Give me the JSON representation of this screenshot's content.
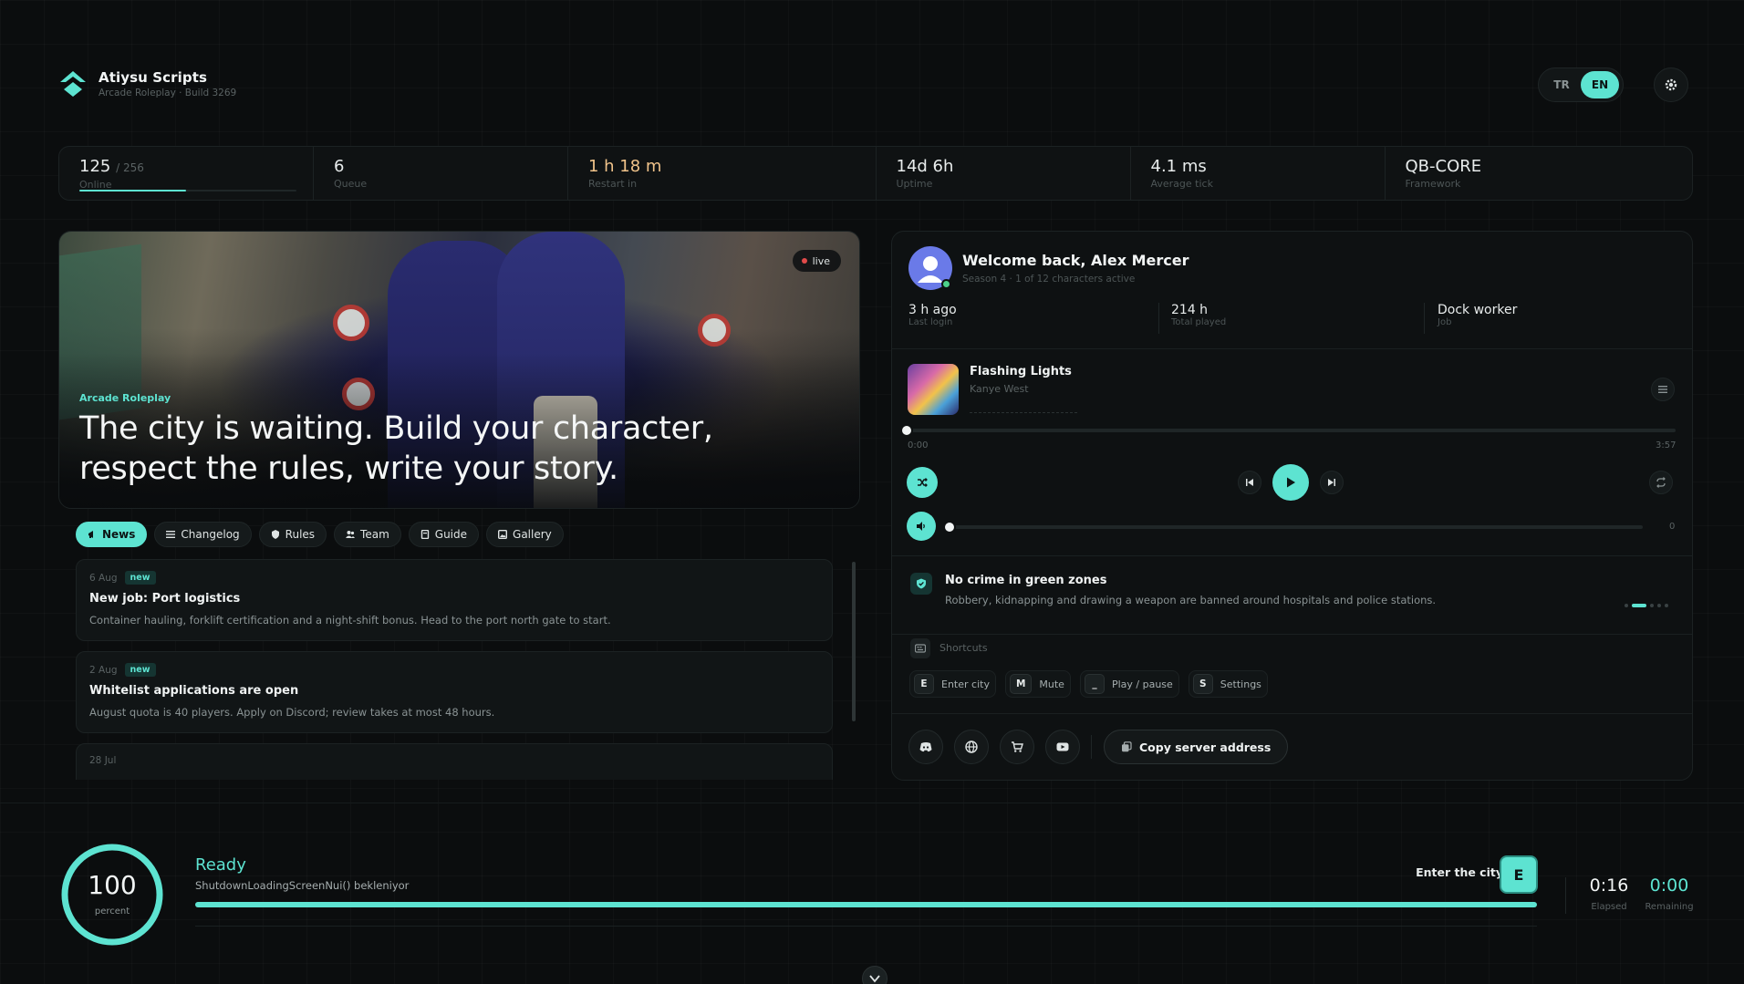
{
  "brand": {
    "title": "Atiysu Scripts",
    "subtitle": "Arcade Roleplay · Build 3269"
  },
  "lang": {
    "tr": "TR",
    "en": "EN",
    "active": "EN"
  },
  "stats": [
    {
      "value": "125",
      "max": "/ 256",
      "label": "Online",
      "progress": 0.49
    },
    {
      "value": "6",
      "label": "Queue"
    },
    {
      "value": "1 h 18 m",
      "label": "Restart in"
    },
    {
      "value": "14d 6h",
      "label": "Uptime"
    },
    {
      "value": "4.1 ms",
      "label": "Average tick"
    },
    {
      "value": "QB-CORE",
      "label": "Framework"
    }
  ],
  "hero": {
    "live": "live",
    "tag": "Arcade Roleplay",
    "title": "The city is waiting. Build your character, respect the rules, write your story."
  },
  "tabs": [
    {
      "label": "News",
      "icon": "megaphone-icon"
    },
    {
      "label": "Changelog",
      "icon": "list-icon"
    },
    {
      "label": "Rules",
      "icon": "shield-icon"
    },
    {
      "label": "Team",
      "icon": "users-icon"
    },
    {
      "label": "Guide",
      "icon": "book-icon"
    },
    {
      "label": "Gallery",
      "icon": "image-icon"
    }
  ],
  "news": [
    {
      "date": "6 Aug",
      "badge": "new",
      "title": "New job: Port logistics",
      "desc": "Container hauling, forklift certification and a night-shift bonus. Head to the port north gate to start."
    },
    {
      "date": "2 Aug",
      "badge": "new",
      "title": "Whitelist applications are open",
      "desc": "August quota is 40 players. Apply on Discord; review takes at most 48 hours."
    },
    {
      "date": "28 Jul",
      "badge": "",
      "title": "",
      "desc": ""
    }
  ],
  "profile": {
    "welcome": "Welcome back, Alex Mercer",
    "sub": "Season 4 · 1 of 12 characters active",
    "stats": [
      {
        "value": "3 h ago",
        "label": "Last login"
      },
      {
        "value": "214 h",
        "label": "Total played"
      },
      {
        "value": "Dock worker",
        "label": "Job"
      }
    ]
  },
  "player": {
    "track": "Flashing Lights",
    "artist": "Kanye West",
    "elapsed": "0:00",
    "duration": "3:57",
    "progress": 0.0,
    "volume": "0",
    "volume_level": 0.0
  },
  "rule": {
    "title": "No crime in green zones",
    "desc": "Robbery, kidnapping and drawing a weapon are banned around hospitals and police stations.",
    "index": 1,
    "count": 5
  },
  "shortcuts": {
    "title": "Shortcuts",
    "items": [
      {
        "key": "E",
        "label": "Enter city"
      },
      {
        "key": "M",
        "label": "Mute"
      },
      {
        "key": "_",
        "label": "Play / pause"
      },
      {
        "key": "S",
        "label": "Settings"
      }
    ]
  },
  "social": [
    "discord-icon",
    "globe-icon",
    "cart-icon",
    "youtube-icon"
  ],
  "copy_label": "Copy server address",
  "loading": {
    "percent": "100",
    "percent_label": "percent",
    "progress": 1.0,
    "status": "Ready",
    "sub": "ShutdownLoadingScreenNui() bekleniyor",
    "enter_label": "Enter the city",
    "enter_key": "E",
    "elapsed": "0:16",
    "elapsed_label": "Elapsed",
    "remaining": "0:00",
    "remaining_label": "Remaining"
  },
  "colors": {
    "accent": "#5de3d1",
    "warn": "#f0c38a",
    "bg": "#0b0d0e"
  }
}
